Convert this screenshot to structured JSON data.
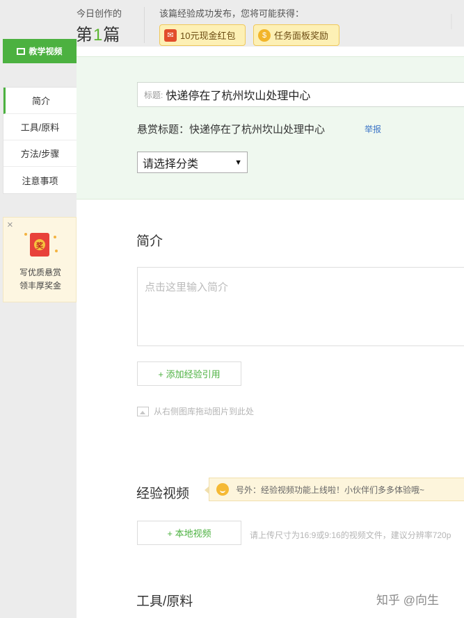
{
  "header": {
    "today_label": "今日创作的",
    "today_prefix": "第",
    "today_number": "1",
    "today_suffix": "篇",
    "reward_label": "该篇经验成功发布，您将可能获得：",
    "reward_buttons": [
      {
        "label": "10元现金红包",
        "icon": "red-envelope-icon"
      },
      {
        "label": "任务面板奖励",
        "icon": "gold-coin-icon"
      }
    ]
  },
  "sidebar": {
    "video_tab": "教学视频",
    "items": [
      {
        "label": "简介",
        "active": true
      },
      {
        "label": "工具/原料",
        "active": false
      },
      {
        "label": "方法/步骤",
        "active": false
      },
      {
        "label": "注意事项",
        "active": false
      }
    ],
    "promo": {
      "close": "×",
      "envelope_char": "奖",
      "line1": "写优质悬赏",
      "line2": "领丰厚奖金"
    }
  },
  "form": {
    "title_label": "标题:",
    "title_value": "快递停在了杭州坎山处理中心",
    "reward_title": "悬赏标题：快递停在了杭州坎山处理中心",
    "report_link": "举报",
    "category_placeholder": "请选择分类",
    "category_arrow": "▼"
  },
  "intro": {
    "heading": "简介",
    "placeholder": "点击这里输入简介",
    "add_reference": "+ 添加经验引用",
    "drag_hint": "从右侧图库拖动图片到此处"
  },
  "video": {
    "heading": "经验视频",
    "tip": "号外：经验视频功能上线啦！小伙伴们多多体验哦~",
    "local_video": "+ 本地视频",
    "upload_hint": "请上传尺寸为16:9或9:16的视频文件，建议分辨率720p"
  },
  "tools": {
    "heading": "工具/原料"
  },
  "watermark": "知乎 @向生",
  "colors": {
    "accent_green": "#4cb140",
    "panel_green_bg": "#eff8ef",
    "link_blue": "#3b74c6",
    "reward_yellow": "#fdf0b5"
  }
}
